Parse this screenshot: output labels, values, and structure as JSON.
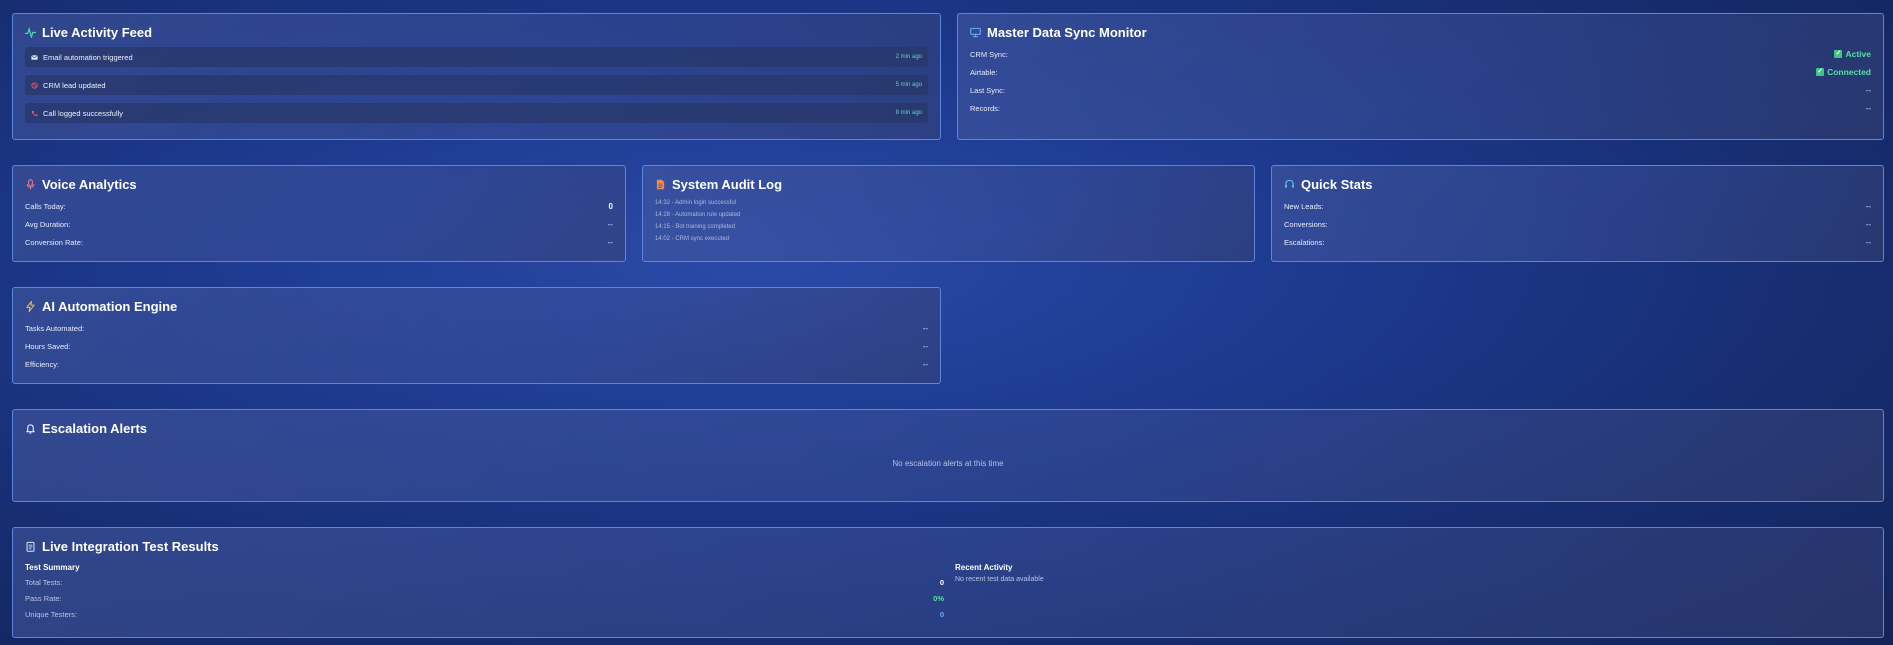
{
  "live_activity_feed": {
    "title": "Live Activity Feed",
    "items": [
      {
        "icon": "email-icon",
        "text": "Email automation triggered",
        "time": "2 min ago"
      },
      {
        "icon": "crm-icon",
        "text": "CRM lead updated",
        "time": "5 min ago"
      },
      {
        "icon": "phone-icon",
        "text": "Call logged successfully",
        "time": "8 min ago"
      }
    ]
  },
  "master_data_sync": {
    "title": "Master Data Sync Monitor",
    "rows": [
      {
        "label": "CRM Sync:",
        "value": "Active"
      },
      {
        "label": "Airtable:",
        "value": "Connected"
      },
      {
        "label": "Last Sync:",
        "value": "--"
      },
      {
        "label": "Records:",
        "value": "--"
      }
    ]
  },
  "voice_analytics": {
    "title": "Voice Analytics",
    "rows": [
      {
        "label": "Calls Today:",
        "value": "0"
      },
      {
        "label": "Avg Duration:",
        "value": "--"
      },
      {
        "label": "Conversion Rate:",
        "value": "--"
      }
    ]
  },
  "system_audit_log": {
    "title": "System Audit Log",
    "lines": [
      "14:32 - Admin login successful",
      "14:28 - Automation rule updated",
      "14:15 - Bot training completed",
      "14:02 - CRM sync executed"
    ]
  },
  "quick_stats": {
    "title": "Quick Stats",
    "rows": [
      {
        "label": "New Leads:",
        "value": "--"
      },
      {
        "label": "Conversions:",
        "value": "--"
      },
      {
        "label": "Escalations:",
        "value": "--"
      }
    ]
  },
  "ai_automation_engine": {
    "title": "AI Automation Engine",
    "rows": [
      {
        "label": "Tasks Automated:",
        "value": "--"
      },
      {
        "label": "Hours Saved:",
        "value": "--"
      },
      {
        "label": "Efficiency:",
        "value": "--"
      }
    ]
  },
  "escalation_alerts": {
    "title": "Escalation Alerts",
    "empty_message": "No escalation alerts at this time"
  },
  "integration_tests": {
    "title": "Live Integration Test Results",
    "summary_heading": "Test Summary",
    "rows": [
      {
        "label": "Total Tests:",
        "value": "0"
      },
      {
        "label": "Pass Rate:",
        "value": "0%"
      },
      {
        "label": "Unique Testers:",
        "value": "0"
      }
    ],
    "activity_heading": "Recent Activity",
    "activity_empty": "No recent test data available"
  },
  "colors": {
    "accent_green": "#57e0a0",
    "card_border": "#5b86e0",
    "time_teal": "#5fd0c4"
  }
}
